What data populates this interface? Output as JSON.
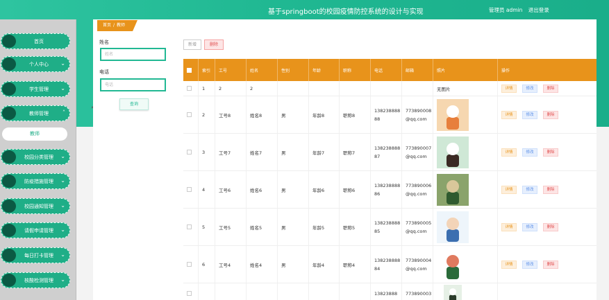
{
  "header": {
    "title": "基于springboot的校园疫情防控系统的设计与实现",
    "user_label": "管理员 admin",
    "logout_label": "退出登录"
  },
  "sidebar": {
    "items": [
      {
        "label": "首页",
        "has_chevron": false
      },
      {
        "label": "个人中心",
        "has_chevron": true
      },
      {
        "label": "学生管理",
        "has_chevron": true
      },
      {
        "label": "教师管理",
        "has_chevron": true,
        "expanded": true
      },
      {
        "label": "校园分类管理",
        "has_chevron": true
      },
      {
        "label": "防疫措施管理",
        "has_chevron": true
      },
      {
        "label": "校园通知管理",
        "has_chevron": true
      },
      {
        "label": "请假申请管理",
        "has_chevron": true
      },
      {
        "label": "每日打卡管理",
        "has_chevron": true
      },
      {
        "label": "核酸检测管理",
        "has_chevron": true
      }
    ],
    "submenu_label": "教师"
  },
  "breadcrumb": {
    "home": "首页",
    "separator": "/",
    "current": "教师"
  },
  "search": {
    "name_label": "姓名",
    "name_placeholder": "姓名",
    "phone_label": "电话",
    "phone_placeholder": "电话",
    "button_label": "查询"
  },
  "toolbar": {
    "add_label": "新增",
    "delete_label": "删除"
  },
  "table": {
    "columns": [
      "",
      "索引",
      "工号",
      "姓名",
      "性别",
      "年龄",
      "职称",
      "电话",
      "邮箱",
      "照片",
      "操作"
    ],
    "actions": {
      "detail": "详情",
      "edit": "修改",
      "delete": "删除"
    },
    "rows": [
      {
        "index": "1",
        "job_no": "2",
        "name": "2",
        "gender": "",
        "age": "",
        "title": "",
        "phone": "",
        "email": "",
        "photo": "无图片"
      },
      {
        "index": "2",
        "job_no": "工号8",
        "name": "姓名8",
        "gender": "男",
        "age": "年龄8",
        "title": "职称8",
        "phone": "13823888888",
        "email": "773890008@qq.com",
        "photo": ""
      },
      {
        "index": "3",
        "job_no": "工号7",
        "name": "姓名7",
        "gender": "男",
        "age": "年龄7",
        "title": "职称7",
        "phone": "13823888887",
        "email": "773890007@qq.com",
        "photo": ""
      },
      {
        "index": "4",
        "job_no": "工号6",
        "name": "姓名6",
        "gender": "男",
        "age": "年龄6",
        "title": "职称6",
        "phone": "13823888886",
        "email": "773890006@qq.com",
        "photo": ""
      },
      {
        "index": "5",
        "job_no": "工号5",
        "name": "姓名5",
        "gender": "男",
        "age": "年龄5",
        "title": "职称5",
        "phone": "13823888885",
        "email": "773890005@qq.com",
        "photo": ""
      },
      {
        "index": "6",
        "job_no": "工号4",
        "name": "姓名4",
        "gender": "男",
        "age": "年龄4",
        "title": "职称4",
        "phone": "13823888884",
        "email": "773890004@qq.com",
        "photo": ""
      },
      {
        "index": "",
        "job_no": "",
        "name": "",
        "gender": "",
        "age": "",
        "title": "",
        "phone": "13823888",
        "email": "773890003",
        "photo": ""
      }
    ]
  },
  "colors": {
    "accent": "#1fae87",
    "header_orange": "#e8931b"
  }
}
